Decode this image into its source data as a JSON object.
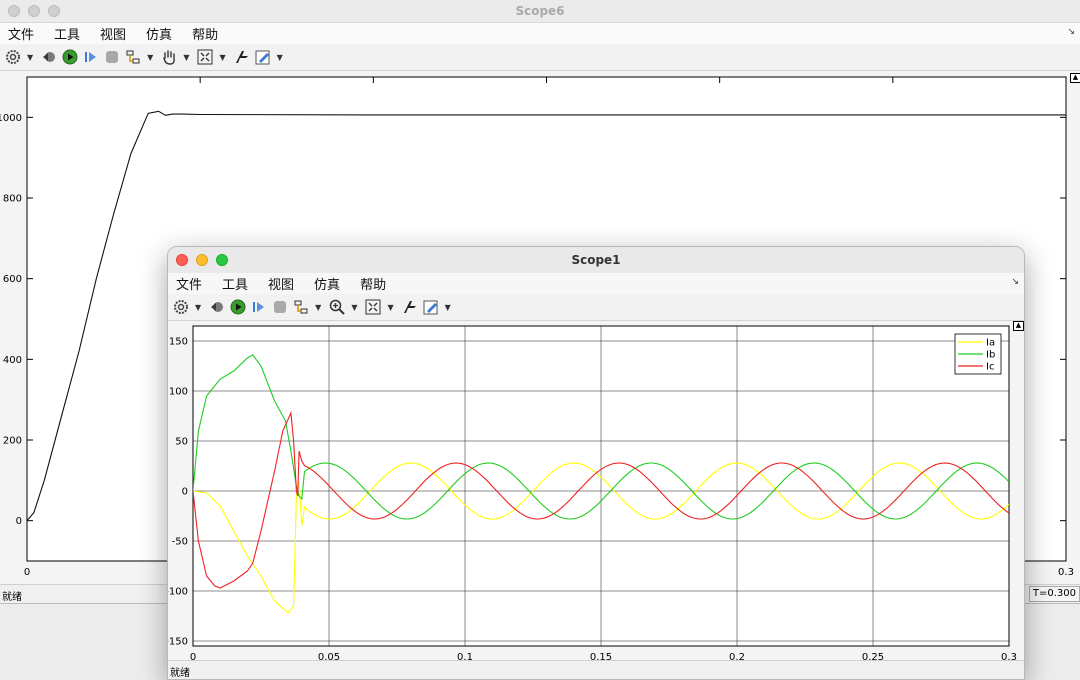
{
  "scope6": {
    "title": "Scope6",
    "menu": [
      "文件",
      "工具",
      "视图",
      "仿真",
      "帮助"
    ],
    "status": "就绪",
    "time_readout": "T=0.300",
    "chart_data": {
      "type": "line",
      "xlim": [
        0,
        0.3
      ],
      "ylim": [
        -100,
        1100
      ],
      "x_ticks": [
        0,
        0.3
      ],
      "x_tick_labels": [
        "0",
        "0.3"
      ],
      "y_ticks": [
        0,
        200,
        400,
        600,
        800,
        1000
      ],
      "y_tick_labels": [
        "0",
        "200",
        "400",
        "600",
        "800",
        "1000"
      ],
      "grid": false,
      "series": [
        {
          "color": "#111111",
          "x": [
            0,
            0.002,
            0.005,
            0.01,
            0.015,
            0.02,
            0.025,
            0.03,
            0.035,
            0.038,
            0.04,
            0.042,
            0.045,
            0.05,
            0.1,
            0.2,
            0.3
          ],
          "y": [
            0,
            20,
            100,
            260,
            420,
            600,
            760,
            910,
            1010,
            1015,
            1005,
            1008,
            1008,
            1007,
            1006,
            1006,
            1006
          ]
        }
      ]
    }
  },
  "scope1": {
    "title": "Scope1",
    "menu": [
      "文件",
      "工具",
      "视图",
      "仿真",
      "帮助"
    ],
    "status": "就绪",
    "chart_data": {
      "type": "line",
      "xlim": [
        0,
        0.3
      ],
      "ylim": [
        -155,
        165
      ],
      "x_ticks": [
        0,
        0.05,
        0.1,
        0.15,
        0.2,
        0.25,
        0.3
      ],
      "x_tick_labels": [
        "0",
        "0.05",
        "0.1",
        "0.15",
        "0.2",
        "0.25",
        "0.3"
      ],
      "y_ticks": [
        -150,
        -100,
        -50,
        0,
        50,
        100,
        150
      ],
      "y_tick_labels": [
        "-150",
        "-100",
        "-50",
        "0",
        "50",
        "100",
        "150"
      ],
      "grid": true,
      "legend_position": "top-right",
      "steady_state": {
        "amplitude": 28,
        "frequency_hz": 16.7
      },
      "series": [
        {
          "name": "Ia",
          "color": "#ffff00",
          "x": [
            0,
            0.005,
            0.01,
            0.015,
            0.02,
            0.025,
            0.03,
            0.035,
            0.037,
            0.038,
            0.039,
            0.04
          ],
          "y": [
            0,
            -2,
            -15,
            -40,
            -65,
            -85,
            -110,
            -122,
            -115,
            -5,
            10,
            -35
          ]
        },
        {
          "name": "Ib",
          "color": "#22cc22",
          "x": [
            0,
            0.002,
            0.005,
            0.01,
            0.015,
            0.02,
            0.022,
            0.025,
            0.03,
            0.034,
            0.036,
            0.038,
            0.039,
            0.04
          ],
          "y": [
            0,
            60,
            95,
            112,
            120,
            133,
            136,
            125,
            90,
            70,
            40,
            5,
            -5,
            -8
          ]
        },
        {
          "name": "Ic",
          "color": "#ee2222",
          "x": [
            0,
            0.002,
            0.005,
            0.008,
            0.01,
            0.015,
            0.02,
            0.022,
            0.025,
            0.03,
            0.033,
            0.036,
            0.037,
            0.038,
            0.0385,
            0.039,
            0.04
          ],
          "y": [
            0,
            -50,
            -85,
            -95,
            -97,
            -90,
            -80,
            -72,
            -40,
            20,
            60,
            78,
            50,
            0,
            -5,
            40,
            30
          ]
        }
      ]
    }
  }
}
